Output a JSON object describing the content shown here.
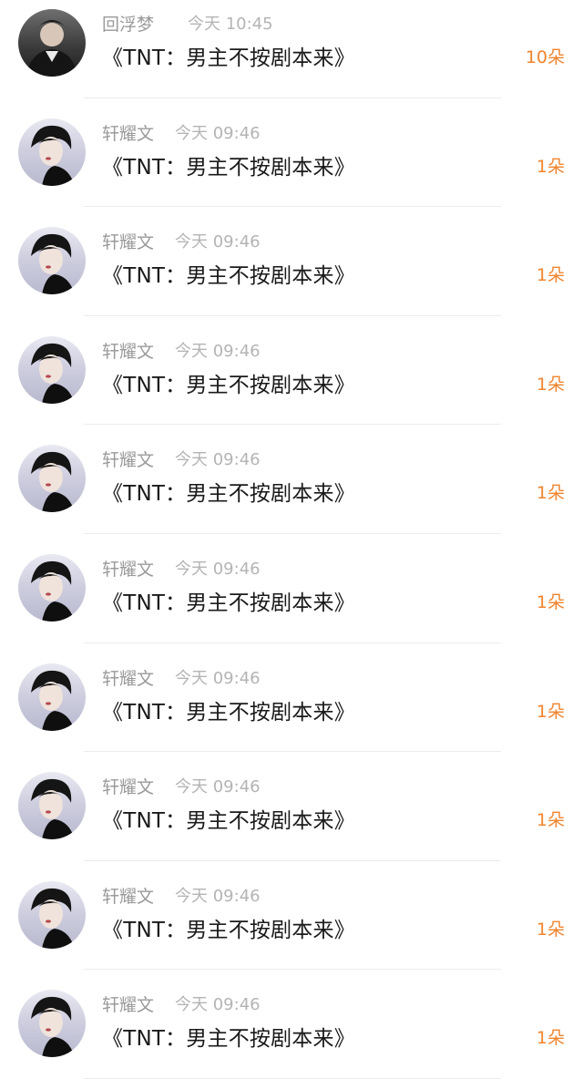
{
  "items": [
    {
      "name": "回浮梦",
      "time": "今天 10:45",
      "title": "《TNT：男主不按剧本来》",
      "count": "10朵"
    },
    {
      "name": "轩耀文",
      "time": "今天 09:46",
      "title": "《TNT：男主不按剧本来》",
      "count": "1朵"
    },
    {
      "name": "轩耀文",
      "time": "今天 09:46",
      "title": "《TNT：男主不按剧本来》",
      "count": "1朵"
    },
    {
      "name": "轩耀文",
      "time": "今天 09:46",
      "title": "《TNT：男主不按剧本来》",
      "count": "1朵"
    },
    {
      "name": "轩耀文",
      "time": "今天 09:46",
      "title": "《TNT：男主不按剧本来》",
      "count": "1朵"
    },
    {
      "name": "轩耀文",
      "time": "今天 09:46",
      "title": "《TNT：男主不按剧本来》",
      "count": "1朵"
    },
    {
      "name": "轩耀文",
      "time": "今天 09:46",
      "title": "《TNT：男主不按剧本来》",
      "count": "1朵"
    },
    {
      "name": "轩耀文",
      "time": "今天 09:46",
      "title": "《TNT：男主不按剧本来》",
      "count": "1朵"
    },
    {
      "name": "轩耀文",
      "time": "今天 09:46",
      "title": "《TNT：男主不按剧本来》",
      "count": "1朵"
    },
    {
      "name": "轩耀文",
      "time": "今天 09:46",
      "title": "《TNT：男主不按剧本来》",
      "count": "1朵"
    }
  ],
  "colors": {
    "count": "#f0852f",
    "name": "#9a9a9a",
    "time": "#b4b4b4",
    "title": "#1a1a1a",
    "divider": "#ececec"
  }
}
